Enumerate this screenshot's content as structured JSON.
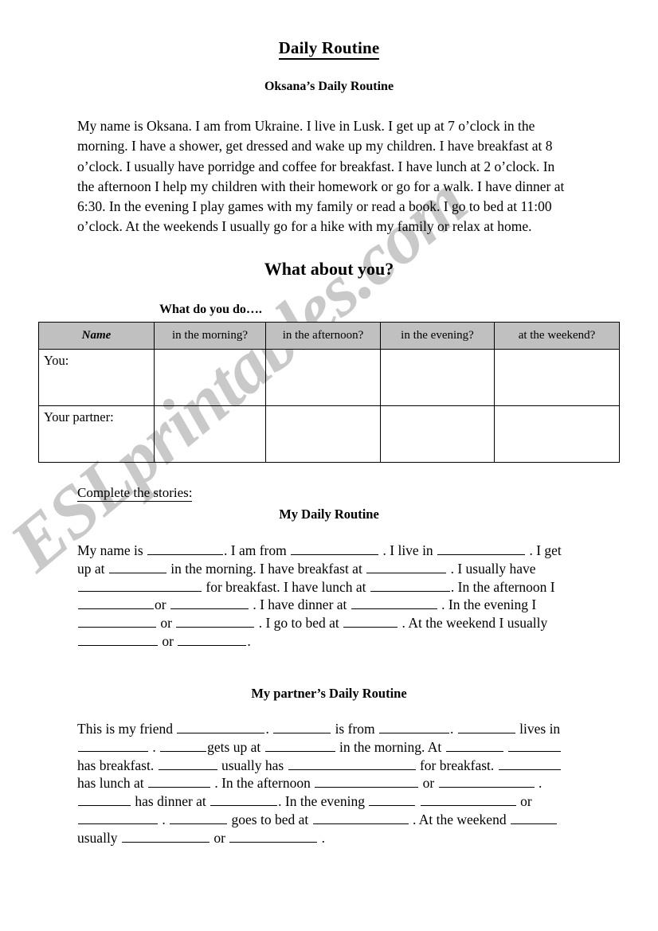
{
  "document": {
    "title": "Daily Routine",
    "subtitle": "Oksana’s Daily Routine",
    "story": "My name is Oksana. I am from Ukraine. I live in Lusk. I get up at 7 o’clock in the morning. I have a shower, get dressed and wake up my children. I have breakfast at 8 o’clock. I usually have porridge and coffee for breakfast. I have lunch at 2 o’clock. In the afternoon I help my children with their homework or go for a walk. I have dinner at 6:30. In the evening I play games with my family or read a book. I go to bed at 11:00 o’clock.  At the weekends I usually go for a hike with my family or relax at home.",
    "prompt_heading": "What about you?",
    "table_caption": "What do you do….",
    "complete_label": "Complete the stories:"
  },
  "watermark": {
    "text": "ESLprintables.com",
    "color": "#c9c9c9"
  },
  "table": {
    "headers": [
      "Name",
      "in the morning?",
      "in the afternoon?",
      "in the evening?",
      "at the weekend?"
    ],
    "rows": [
      {
        "label": "You:",
        "cells": [
          "",
          "",
          "",
          ""
        ]
      },
      {
        "label": "Your partner:",
        "cells": [
          "",
          "",
          "",
          ""
        ]
      }
    ],
    "header_bg": "#c0c0c0",
    "border_color": "#000000"
  },
  "my_routine": {
    "heading": "My Daily Routine",
    "segments": [
      {
        "t": "text",
        "v": "My name is "
      },
      {
        "t": "blank",
        "w": 95
      },
      {
        "t": "text",
        "v": ". I am from "
      },
      {
        "t": "blank",
        "w": 110
      },
      {
        "t": "text",
        "v": " . I live in "
      },
      {
        "t": "blank",
        "w": 110
      },
      {
        "t": "text",
        "v": " . I get up at "
      },
      {
        "t": "blank",
        "w": 72
      },
      {
        "t": "text",
        "v": " in the morning. I have breakfast at "
      },
      {
        "t": "blank",
        "w": 100
      },
      {
        "t": "text",
        "v": " . I usually have "
      },
      {
        "t": "blank",
        "w": 155
      },
      {
        "t": "text",
        "v": " for breakfast. I have lunch at "
      },
      {
        "t": "blank",
        "w": 100
      },
      {
        "t": "text",
        "v": ". In the afternoon I "
      },
      {
        "t": "blank",
        "w": 95
      },
      {
        "t": "text",
        "v": "or "
      },
      {
        "t": "blank",
        "w": 98
      },
      {
        "t": "text",
        "v": " . I have dinner at "
      },
      {
        "t": "blank",
        "w": 108
      },
      {
        "t": "text",
        "v": " . In the evening I "
      },
      {
        "t": "blank",
        "w": 98
      },
      {
        "t": "text",
        "v": " or "
      },
      {
        "t": "blank",
        "w": 98
      },
      {
        "t": "text",
        "v": " . I go to bed at "
      },
      {
        "t": "blank",
        "w": 68
      },
      {
        "t": "text",
        "v": " . At the weekend I usually "
      },
      {
        "t": "blank",
        "w": 100
      },
      {
        "t": "text",
        "v": " or "
      },
      {
        "t": "blank",
        "w": 86
      },
      {
        "t": "text",
        "v": "."
      }
    ]
  },
  "partner_routine": {
    "heading": "My partner’s Daily Routine",
    "segments": [
      {
        "t": "text",
        "v": "This is my friend "
      },
      {
        "t": "blank",
        "w": 110
      },
      {
        "t": "text",
        "v": ".  "
      },
      {
        "t": "blank",
        "w": 72
      },
      {
        "t": "text",
        "v": " is from "
      },
      {
        "t": "blank",
        "w": 88
      },
      {
        "t": "text",
        "v": ". "
      },
      {
        "t": "blank",
        "w": 72
      },
      {
        "t": "text",
        "v": " lives in "
      },
      {
        "t": "blank",
        "w": 88
      },
      {
        "t": "text",
        "v": " .  "
      },
      {
        "t": "blank",
        "w": 58
      },
      {
        "t": "text",
        "v": "gets up at "
      },
      {
        "t": "blank",
        "w": 88
      },
      {
        "t": "text",
        "v": " in the morning.  At "
      },
      {
        "t": "blank",
        "w": 72
      },
      {
        "t": "text",
        "v": " "
      },
      {
        "t": "blank",
        "w": 66
      },
      {
        "t": "text",
        "v": " has breakfast. "
      },
      {
        "t": "blank",
        "w": 74
      },
      {
        "t": "text",
        "v": " usually has "
      },
      {
        "t": "blank",
        "w": 160
      },
      {
        "t": "text",
        "v": " for breakfast. "
      },
      {
        "t": "blank",
        "w": 78
      },
      {
        "t": "text",
        "v": " has lunch at "
      },
      {
        "t": "blank",
        "w": 78
      },
      {
        "t": "text",
        "v": " . In the afternoon "
      },
      {
        "t": "blank",
        "w": 130
      },
      {
        "t": "text",
        "v": " or "
      },
      {
        "t": "blank",
        "w": 120
      },
      {
        "t": "text",
        "v": " . "
      },
      {
        "t": "blank",
        "w": 66
      },
      {
        "t": "text",
        "v": " has dinner at "
      },
      {
        "t": "blank",
        "w": 84
      },
      {
        "t": "text",
        "v": ". In the evening "
      },
      {
        "t": "blank",
        "w": 58
      },
      {
        "t": "text",
        "v": " "
      },
      {
        "t": "blank",
        "w": 120
      },
      {
        "t": "text",
        "v": " or "
      },
      {
        "t": "blank",
        "w": 100
      },
      {
        "t": "text",
        "v": " .  "
      },
      {
        "t": "blank",
        "w": 72
      },
      {
        "t": "text",
        "v": " goes to bed at "
      },
      {
        "t": "blank",
        "w": 120
      },
      {
        "t": "text",
        "v": " . At the weekend "
      },
      {
        "t": "blank",
        "w": 58
      },
      {
        "t": "text",
        "v": " usually "
      },
      {
        "t": "blank",
        "w": 110
      },
      {
        "t": "text",
        "v": " or "
      },
      {
        "t": "blank",
        "w": 110
      },
      {
        "t": "text",
        "v": " ."
      }
    ]
  }
}
